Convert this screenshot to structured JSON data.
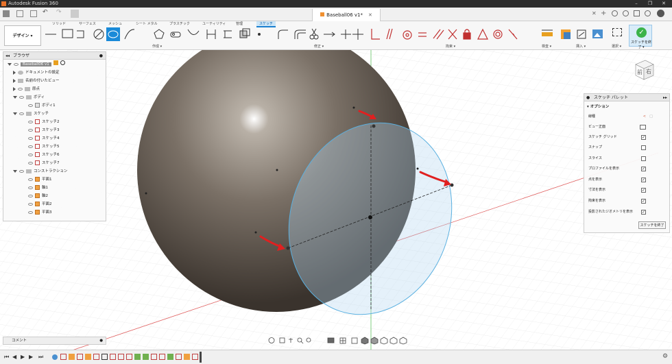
{
  "window": {
    "title": "Autodesk Fusion 360"
  },
  "doc_tab": {
    "title": "Baseball06 v1*"
  },
  "workspace": {
    "label": "デザイン ▾"
  },
  "ribbon_tabs": [
    "ソリッド",
    "サーフェス",
    "メッシュ",
    "シート メタル",
    "プラスチック",
    "ユーティリティ",
    "管理",
    "スケッチ"
  ],
  "ribbon_groups": {
    "create": "作成 ▾",
    "modify": "修正 ▾",
    "constraints": "拘束 ▾",
    "inspect": "検査 ▾",
    "insert": "挿入 ▾",
    "select": "選択 ▾",
    "finish": "スケッチを終了 ▾"
  },
  "browser": {
    "title": "ブラウザ",
    "rows": [
      {
        "label": "Baseball06 v1",
        "level": 0,
        "kind": "root"
      },
      {
        "label": "ドキュメントの設定",
        "level": 1,
        "kind": "gear"
      },
      {
        "label": "名前の付いたビュー",
        "level": 1,
        "kind": "folder"
      },
      {
        "label": "原点",
        "level": 1,
        "kind": "folder"
      },
      {
        "label": "ボディ",
        "level": 1,
        "kind": "folder"
      },
      {
        "label": "ボディ1",
        "level": 2,
        "kind": "body"
      },
      {
        "label": "スケッチ",
        "level": 1,
        "kind": "folder"
      },
      {
        "label": "スケッチ2",
        "level": 2,
        "kind": "sketch"
      },
      {
        "label": "スケッチ3",
        "level": 2,
        "kind": "sketch"
      },
      {
        "label": "スケッチ4",
        "level": 2,
        "kind": "sketch"
      },
      {
        "label": "スケッチ5",
        "level": 2,
        "kind": "sketch"
      },
      {
        "label": "スケッチ6",
        "level": 2,
        "kind": "sketch"
      },
      {
        "label": "スケッチ7",
        "level": 2,
        "kind": "sketch"
      },
      {
        "label": "コンストラクション",
        "level": 1,
        "kind": "folder"
      },
      {
        "label": "平面1",
        "level": 2,
        "kind": "plane"
      },
      {
        "label": "軸1",
        "level": 2,
        "kind": "axis"
      },
      {
        "label": "軸2",
        "level": 2,
        "kind": "axis"
      },
      {
        "label": "平面2",
        "level": 2,
        "kind": "plane"
      },
      {
        "label": "平面3",
        "level": 2,
        "kind": "plane"
      }
    ]
  },
  "palette": {
    "title": "スケッチ パレット",
    "section": "オプション",
    "rows": [
      {
        "label": "線種",
        "control": "linetype"
      },
      {
        "label": "ビュー正面",
        "control": "button"
      },
      {
        "label": "スケッチ グリッド",
        "checked": true
      },
      {
        "label": "スナップ",
        "checked": false
      },
      {
        "label": "スライス",
        "checked": false
      },
      {
        "label": "プロファイルを表示",
        "checked": true
      },
      {
        "label": "点を表示",
        "checked": true
      },
      {
        "label": "寸法を表示",
        "checked": true
      },
      {
        "label": "拘束を表示",
        "checked": true
      },
      {
        "label": "投影されたジオメトリを表示",
        "checked": true
      }
    ],
    "finish_button": "スケッチを終了"
  },
  "comment": {
    "label": "コメント"
  },
  "viewcube": {
    "front": "前",
    "right": "右"
  }
}
